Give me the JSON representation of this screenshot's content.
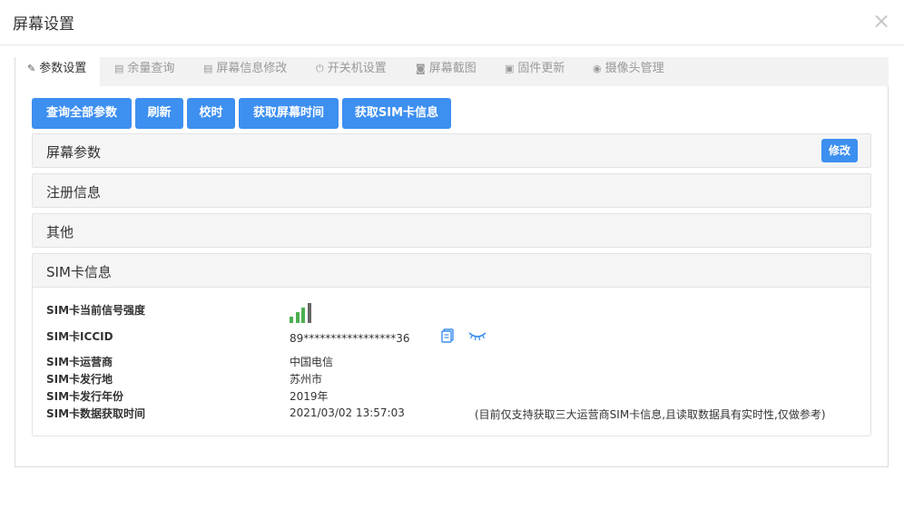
{
  "dialog": {
    "title": "屏幕设置",
    "close": "×"
  },
  "tabs": [
    {
      "label": "参数设置",
      "icon": "wrench-icon",
      "glyph": "✎"
    },
    {
      "label": "余量查询",
      "icon": "document-icon",
      "glyph": "▤"
    },
    {
      "label": "屏幕信息修改",
      "icon": "document-icon",
      "glyph": "▤"
    },
    {
      "label": "开关机设置",
      "icon": "power-icon",
      "glyph": "⏻"
    },
    {
      "label": "屏幕截图",
      "icon": "camera-icon",
      "glyph": "◙"
    },
    {
      "label": "固件更新",
      "icon": "firmware-icon",
      "glyph": "▣"
    },
    {
      "label": "摄像头管理",
      "icon": "webcam-icon",
      "glyph": "◉"
    }
  ],
  "toolbar": {
    "query_all": "查询全部参数",
    "refresh": "刷新",
    "sync_time": "校时",
    "get_screen_time": "获取屏幕时间",
    "get_sim_info": "获取SIM卡信息"
  },
  "sections": {
    "screen_params": "屏幕参数",
    "edit": "修改",
    "registration": "注册信息",
    "other": "其他",
    "sim_info": "SIM卡信息"
  },
  "sim": {
    "signal_label": "SIM卡当前信号强度",
    "signal_level": 3,
    "signal_max": 4,
    "iccid_label": "SIM卡ICCID",
    "iccid_value": "89*****************36",
    "carrier_label": "SIM卡运营商",
    "carrier_value": "中国电信",
    "issue_place_label": "SIM卡发行地",
    "issue_place_value": "苏州市",
    "issue_year_label": "SIM卡发行年份",
    "issue_year_value": "2019年",
    "fetch_time_label": "SIM卡数据获取时间",
    "fetch_time_value": "2021/03/02 13:57:03",
    "note": "(目前仅支持获取三大运营商SIM卡信息,且读取数据具有实时性,仅做参考)"
  },
  "colors": {
    "primary": "#3d8ff0",
    "signal_on": "#4caf50",
    "signal_off": "#666666",
    "tab_bar": "#f2f2f2"
  }
}
